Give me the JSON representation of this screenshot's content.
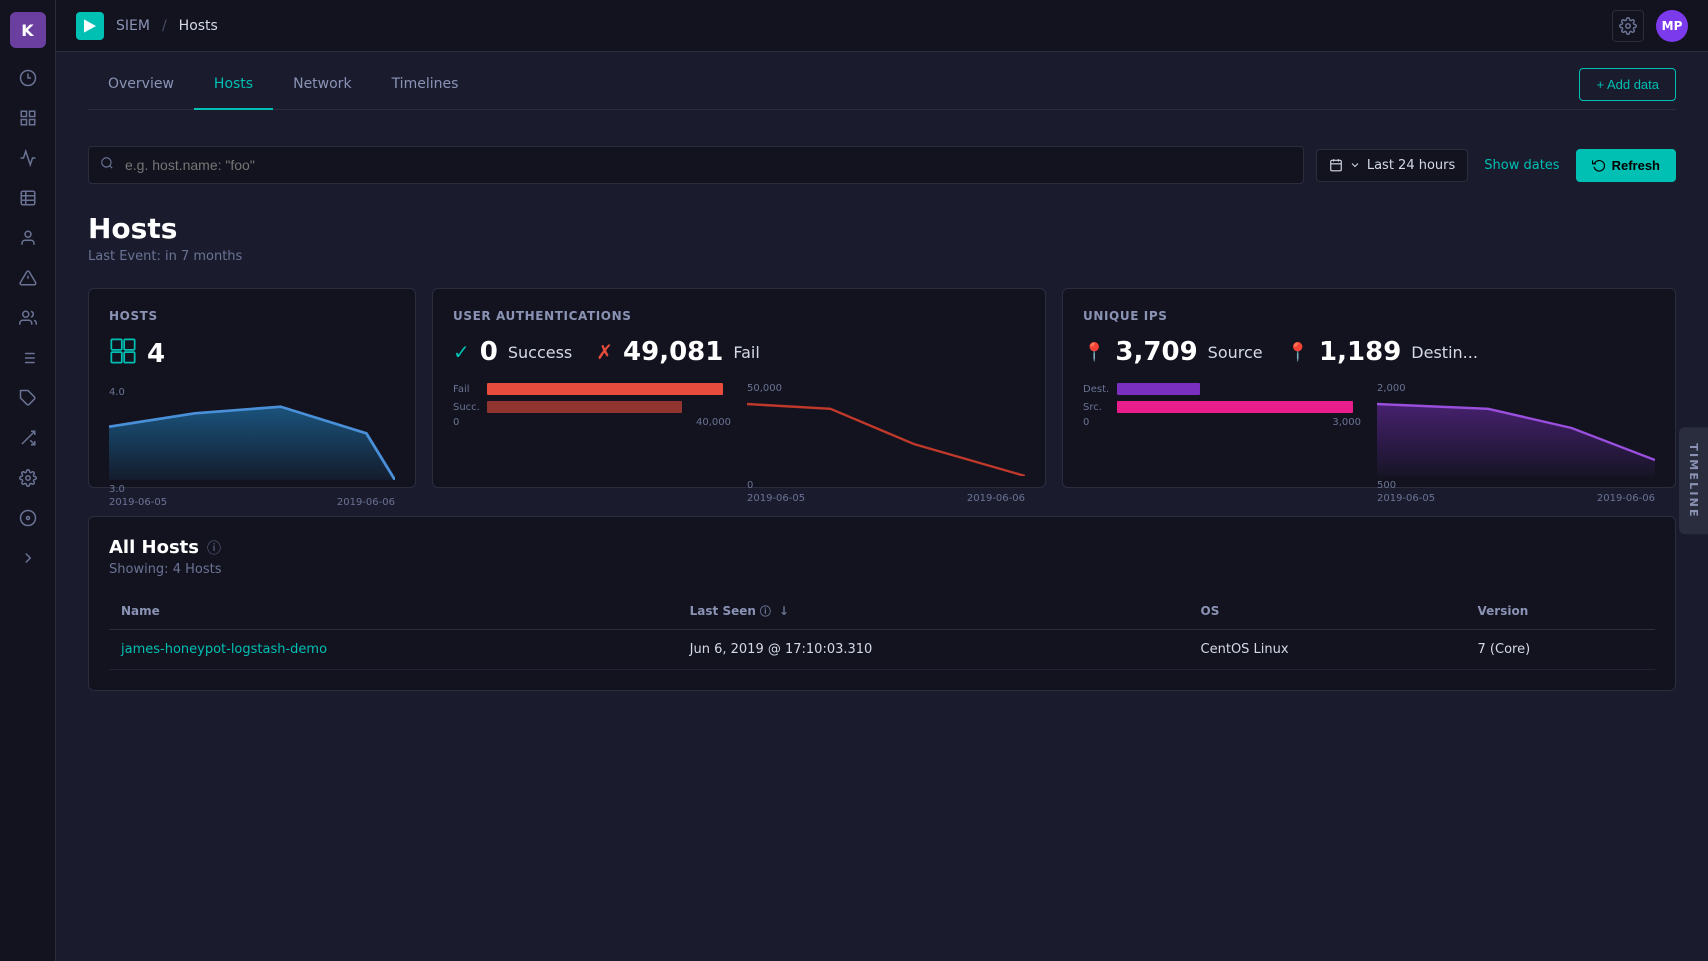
{
  "app": {
    "logo_text": "K",
    "app_name": "SIEM",
    "page_name": "Hosts",
    "avatar_initials": "MP"
  },
  "nav": {
    "tabs": [
      {
        "id": "overview",
        "label": "Overview",
        "active": false
      },
      {
        "id": "hosts",
        "label": "Hosts",
        "active": true
      },
      {
        "id": "network",
        "label": "Network",
        "active": false
      },
      {
        "id": "timelines",
        "label": "Timelines",
        "active": false
      }
    ],
    "add_data_label": "+ Add data"
  },
  "search": {
    "placeholder": "e.g. host.name: \"foo\"",
    "time_range": "Last 24 hours",
    "show_dates_label": "Show dates",
    "refresh_label": "Refresh"
  },
  "page_heading": {
    "title": "Hosts",
    "subtitle": "Last Event: in 7 months"
  },
  "stats": {
    "hosts_card": {
      "title": "Hosts",
      "count": "4",
      "x_labels": [
        "2019-06-05",
        "2019-06-06"
      ],
      "y_min": "3.0",
      "y_max": "4.0"
    },
    "auth_card": {
      "title": "User Authentications",
      "success_count": "0",
      "success_label": "Success",
      "fail_count": "49,081",
      "fail_label": "Fail",
      "x_labels": [
        "2019-06-05",
        "2019-06-06"
      ],
      "bar_fail_label": "Fail",
      "bar_succ_label": "Succ.",
      "x_tick_left": "0",
      "x_tick_right": "40,000",
      "line_x_left": "0",
      "line_x_right": "50,000"
    },
    "ips_card": {
      "title": "Unique IPs",
      "source_count": "3,709",
      "source_label": "Source",
      "dest_count": "1,189",
      "dest_label": "Destin...",
      "bar_dest_label": "Dest.",
      "bar_src_label": "Src.",
      "x_tick_left": "0",
      "x_tick_right": "3,000",
      "line_y_max": "2,000",
      "line_y_min": "500",
      "x_labels_left": "2019-06-05",
      "x_labels_right": "2019-06-06"
    }
  },
  "all_hosts": {
    "title": "All Hosts",
    "showing": "Showing: 4 Hosts",
    "columns": [
      "Name",
      "Last Seen",
      "OS",
      "Version"
    ],
    "rows": [
      {
        "name": "james-honeypot-logstash-demo",
        "last_seen": "Jun 6, 2019 @ 17:10:03.310",
        "os": "CentOS Linux",
        "version": "7 (Core)"
      }
    ]
  },
  "timeline_sidebar": {
    "label": "TIMELINE"
  },
  "sidebar_icons": [
    {
      "name": "clock-icon",
      "symbol": "🕐"
    },
    {
      "name": "dashboard-icon",
      "symbol": "⊞"
    },
    {
      "name": "chart-icon",
      "symbol": "📊"
    },
    {
      "name": "calendar-icon",
      "symbol": "📅"
    },
    {
      "name": "person-icon",
      "symbol": "👤"
    },
    {
      "name": "alert-icon",
      "symbol": "⚠"
    },
    {
      "name": "team-icon",
      "symbol": "👥"
    },
    {
      "name": "list-icon",
      "symbol": "☰"
    },
    {
      "name": "tag-icon",
      "symbol": "🏷"
    },
    {
      "name": "map-icon",
      "symbol": "🗺"
    },
    {
      "name": "settings-icon",
      "symbol": "⚙"
    },
    {
      "name": "network-icon",
      "symbol": "⬡"
    },
    {
      "name": "brain-icon",
      "symbol": "🧠"
    },
    {
      "name": "code-icon",
      "symbol": "⟨⟩"
    },
    {
      "name": "arrow-icon",
      "symbol": "→"
    }
  ]
}
